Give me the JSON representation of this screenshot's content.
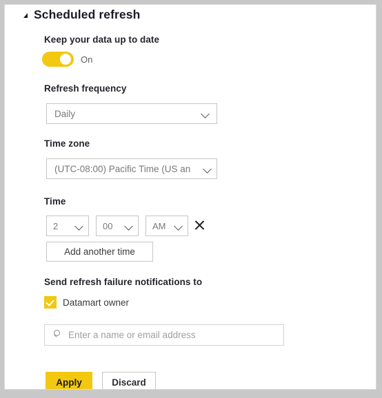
{
  "panel": {
    "section_title": "Scheduled refresh",
    "caret_icon": "caret-collapse-icon"
  },
  "keep_up_to_date": {
    "label": "Keep your data up to date",
    "toggle_state": "On",
    "toggle_on": true,
    "accent_color": "#f2c811"
  },
  "refresh_frequency": {
    "label": "Refresh frequency",
    "value": "Daily",
    "chevron_icon": "chevron-down-icon"
  },
  "time_zone": {
    "label": "Time zone",
    "value": "(UTC-08:00) Pacific Time (US an",
    "chevron_icon": "chevron-down-icon"
  },
  "time": {
    "label": "Time",
    "hour": "2",
    "minute": "00",
    "meridiem": "AM",
    "remove_icon": "close-x-icon",
    "add_another_label": "Add another time"
  },
  "notifications": {
    "label": "Send refresh failure notifications to",
    "checkbox_label": "Datamart owner",
    "checkbox_checked": true,
    "checkbox_color": "#f2c811",
    "search_icon": "search-icon",
    "people_value": "",
    "people_placeholder": "Enter a name or email address"
  },
  "footer": {
    "apply_label": "Apply",
    "discard_label": "Discard",
    "apply_color": "#f2c811"
  }
}
